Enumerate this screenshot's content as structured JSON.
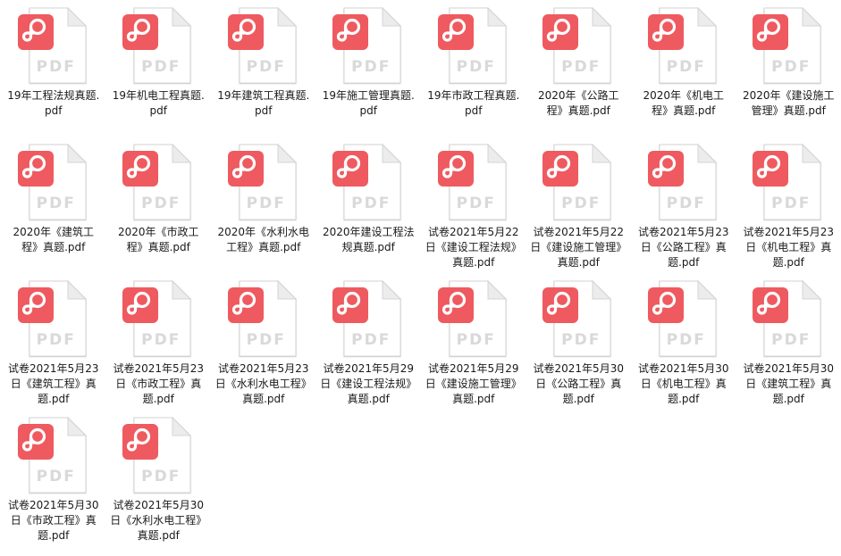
{
  "file_icon": {
    "icon": "pdf-file-icon",
    "badge_label": "PDF",
    "badge_color": "#ee5a5f",
    "sheet_color": "#ffffff",
    "fold_color": "#ececec",
    "label_color": "#d9d9d9"
  },
  "files": [
    {
      "name": "19年工程法规真题.pdf"
    },
    {
      "name": "19年机电工程真题.pdf"
    },
    {
      "name": "19年建筑工程真题.pdf"
    },
    {
      "name": "19年施工管理真题.pdf"
    },
    {
      "name": "19年市政工程真题.pdf"
    },
    {
      "name": "2020年《公路工程》真题.pdf"
    },
    {
      "name": "2020年《机电工程》真题.pdf"
    },
    {
      "name": "2020年《建设施工管理》真题.pdf"
    },
    {
      "name": "2020年《建筑工程》真题.pdf"
    },
    {
      "name": "2020年《市政工程》真题.pdf"
    },
    {
      "name": "2020年《水利水电工程》真题.pdf"
    },
    {
      "name": "2020年建设工程法规真题.pdf"
    },
    {
      "name": "试卷2021年5月22日《建设工程法规》真题.pdf"
    },
    {
      "name": "试卷2021年5月22日《建设施工管理》真题.pdf"
    },
    {
      "name": "试卷2021年5月23日《公路工程》真题.pdf"
    },
    {
      "name": "试卷2021年5月23日《机电工程》真题.pdf"
    },
    {
      "name": "试卷2021年5月23日《建筑工程》真题.pdf"
    },
    {
      "name": "试卷2021年5月23日《市政工程》真题.pdf"
    },
    {
      "name": "试卷2021年5月23日《水利水电工程》真题.pdf"
    },
    {
      "name": "试卷2021年5月29日《建设工程法规》真题.pdf"
    },
    {
      "name": "试卷2021年5月29日《建设施工管理》真题.pdf"
    },
    {
      "name": "试卷2021年5月30日《公路工程》真题.pdf"
    },
    {
      "name": "试卷2021年5月30日《机电工程》真题.pdf"
    },
    {
      "name": "试卷2021年5月30日《建筑工程》真题.pdf"
    },
    {
      "name": "试卷2021年5月30日《市政工程》真题.pdf"
    },
    {
      "name": "试卷2021年5月30日《水利水电工程》真题.pdf"
    }
  ]
}
